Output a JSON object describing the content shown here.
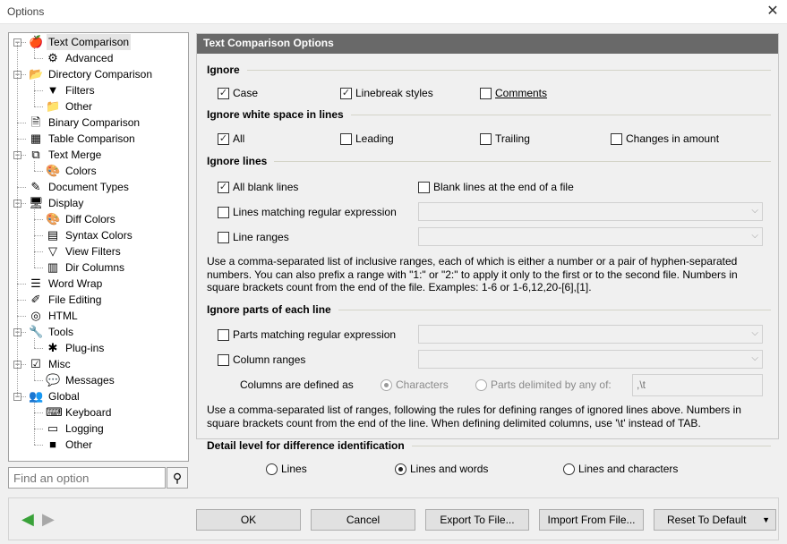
{
  "window": {
    "title": "Options",
    "close": "✕"
  },
  "tree": [
    {
      "label": "Text Comparison",
      "level": 0,
      "icon": "apple-icon",
      "glyph": "🍎",
      "expanded": true,
      "selected": true
    },
    {
      "label": "Advanced",
      "level": 1,
      "icon": "settings-doc-icon",
      "glyph": "⚙"
    },
    {
      "label": "Directory Comparison",
      "level": 0,
      "icon": "folders-icon",
      "glyph": "📂",
      "expanded": true
    },
    {
      "label": "Filters",
      "level": 1,
      "icon": "funnel-icon",
      "glyph": "▼"
    },
    {
      "label": "Other",
      "level": 1,
      "icon": "folder-check-icon",
      "glyph": "📁"
    },
    {
      "label": "Binary Comparison",
      "level": 0,
      "icon": "binary-icon",
      "glyph": "🗎"
    },
    {
      "label": "Table Comparison",
      "level": 0,
      "icon": "table-icon",
      "glyph": "▦"
    },
    {
      "label": "Text Merge",
      "level": 0,
      "icon": "merge-icon",
      "glyph": "⧉",
      "expanded": true
    },
    {
      "label": "Colors",
      "level": 1,
      "icon": "palette-icon",
      "glyph": "🎨"
    },
    {
      "label": "Document Types",
      "level": 0,
      "icon": "document-types-icon",
      "glyph": "✎"
    },
    {
      "label": "Display",
      "level": 0,
      "icon": "monitor-icon",
      "glyph": "🖥",
      "expanded": true
    },
    {
      "label": "Diff Colors",
      "level": 1,
      "icon": "palette-icon",
      "glyph": "🎨"
    },
    {
      "label": "Syntax Colors",
      "level": 1,
      "icon": "syntax-colors-icon",
      "glyph": "▤"
    },
    {
      "label": "View Filters",
      "level": 1,
      "icon": "funnel-icon",
      "glyph": "▽"
    },
    {
      "label": "Dir Columns",
      "level": 1,
      "icon": "columns-icon",
      "glyph": "▥"
    },
    {
      "label": "Word Wrap",
      "level": 0,
      "icon": "word-wrap-icon",
      "glyph": "☰"
    },
    {
      "label": "File Editing",
      "level": 0,
      "icon": "file-edit-icon",
      "glyph": "✐"
    },
    {
      "label": "HTML",
      "level": 0,
      "icon": "html-icon",
      "glyph": "◎"
    },
    {
      "label": "Tools",
      "level": 0,
      "icon": "tools-icon",
      "glyph": "🔧",
      "expanded": true
    },
    {
      "label": "Plug-ins",
      "level": 1,
      "icon": "plugin-icon",
      "glyph": "✱"
    },
    {
      "label": "Misc",
      "level": 0,
      "icon": "misc-icon",
      "glyph": "☑",
      "expanded": true
    },
    {
      "label": "Messages",
      "level": 1,
      "icon": "message-icon",
      "glyph": "💬"
    },
    {
      "label": "Global",
      "level": 0,
      "icon": "users-icon",
      "glyph": "👥",
      "expanded": true
    },
    {
      "label": "Keyboard",
      "level": 1,
      "icon": "keyboard-icon",
      "glyph": "⌨"
    },
    {
      "label": "Logging",
      "level": 1,
      "icon": "log-icon",
      "glyph": "▭"
    },
    {
      "label": "Other",
      "level": 1,
      "icon": "cube-icon",
      "glyph": "■"
    }
  ],
  "search": {
    "placeholder": "Find an option"
  },
  "panel": {
    "header": "Text Comparison Options",
    "ignore": {
      "title": "Ignore",
      "case": "Case",
      "case_checked": true,
      "linebreak": "Linebreak styles",
      "linebreak_checked": true,
      "comments": "Comments",
      "comments_checked": false
    },
    "whitespace": {
      "title": "Ignore white space in lines",
      "all": "All",
      "all_checked": true,
      "leading": "Leading",
      "trailing": "Trailing",
      "changes": "Changes in amount"
    },
    "lines": {
      "title": "Ignore lines",
      "all_blank": "All blank lines",
      "all_blank_checked": true,
      "blank_end": "Blank lines at the end of a file",
      "regex": "Lines matching regular expression",
      "ranges": "Line ranges",
      "help": "Use a comma-separated list of inclusive ranges, each of which is either a number or a pair of hyphen-separated numbers. You can also prefix a range with \"1:\" or \"2:\" to apply it only to the first or to the second file. Numbers in square brackets count from the end of the file. Examples: 1-6 or 1-6,12,20-[6],[1]."
    },
    "parts": {
      "title": "Ignore parts of each line",
      "regex": "Parts matching regular expression",
      "columns": "Column ranges",
      "defined_as": "Columns are defined as",
      "characters": "Characters",
      "delimited": "Parts delimited by any of:",
      "delimiters": ",\\t",
      "help": "Use a comma-separated list of ranges, following the rules for defining ranges of ignored lines above. Numbers in square brackets count from the end of the line. When defining delimited columns, use '\\t' instead of TAB."
    },
    "detail": {
      "title": "Detail level for difference identification",
      "lines": "Lines",
      "words": "Lines and words",
      "chars": "Lines and characters",
      "selected": "Lines and words"
    }
  },
  "buttons": {
    "ok": "OK",
    "cancel": "Cancel",
    "export": "Export To File...",
    "import": "Import From File...",
    "reset": "Reset To Default"
  }
}
